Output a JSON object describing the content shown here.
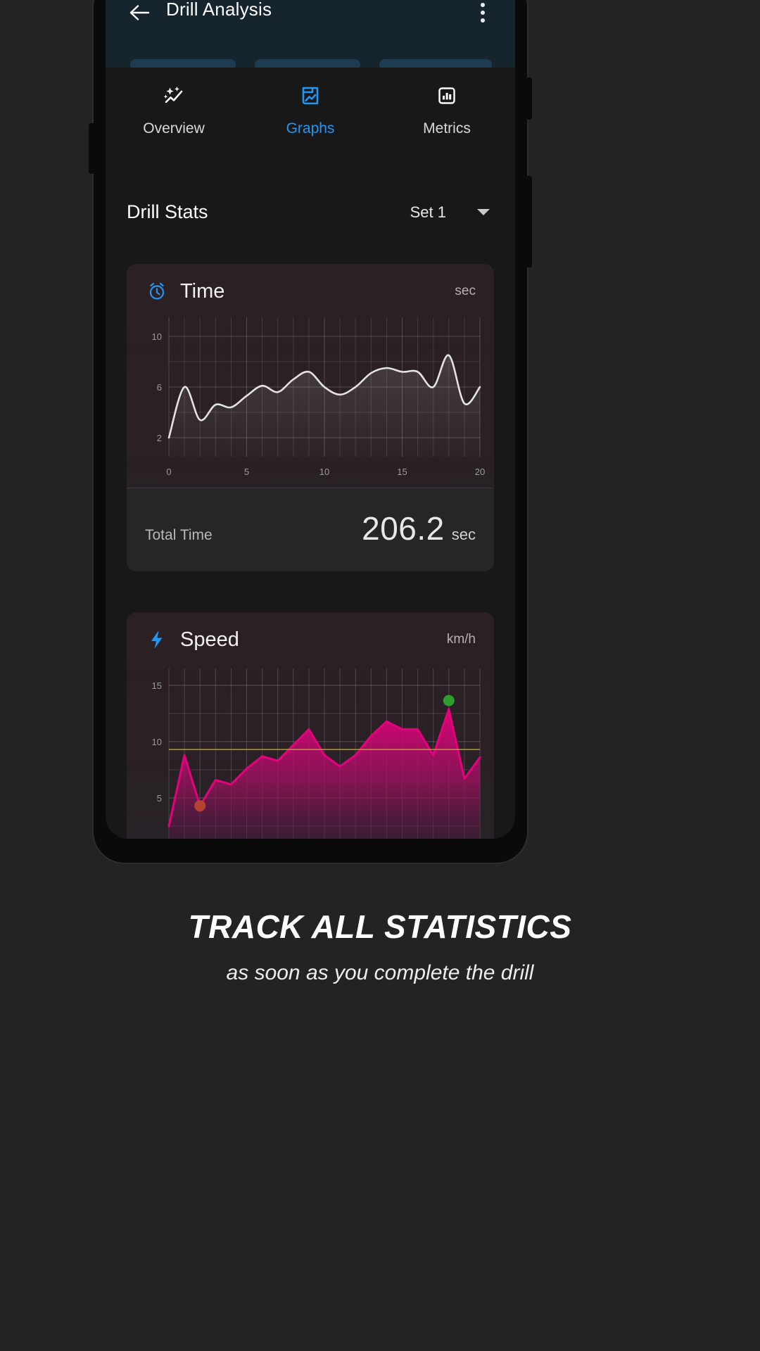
{
  "appbar": {
    "title": "Drill Analysis",
    "back_icon": "arrow-left-icon",
    "overflow_icon": "more-vertical-icon"
  },
  "tabs": [
    {
      "label": "Overview",
      "icon": "sparkle-trend-icon",
      "active": false
    },
    {
      "label": "Graphs",
      "icon": "chart-document-icon",
      "active": true
    },
    {
      "label": "Metrics",
      "icon": "bar-chart-box-icon",
      "active": false
    }
  ],
  "section": {
    "title": "Drill Stats",
    "set_selector": {
      "value": "Set 1",
      "caret_icon": "chevron-down-icon"
    }
  },
  "cards": [
    {
      "title": "Time",
      "unit": "sec",
      "icon": "alarm-clock-icon",
      "footer_label": "Total Time",
      "footer_value": "206.2",
      "footer_unit": "sec"
    },
    {
      "title": "Speed",
      "unit": "km/h",
      "icon": "lightning-bolt-icon"
    }
  ],
  "marketing": {
    "title": "TRACK ALL STATISTICS",
    "subtitle": "as soon as you complete the drill"
  },
  "colors": {
    "accent_blue": "#2196f3",
    "appbar_bg": "#16242e",
    "screen_bg": "#181818",
    "speed_line": "#e5007e",
    "time_line": "#e3e3e3",
    "min_marker": "#b5432f",
    "max_marker": "#2e9e2e",
    "avg_line": "#b89c2a"
  },
  "chart_data": [
    {
      "type": "line",
      "title": "Time",
      "xlabel": "",
      "ylabel": "sec",
      "x": [
        0,
        1,
        2,
        3,
        4,
        5,
        6,
        7,
        8,
        9,
        10,
        11,
        12,
        13,
        14,
        15,
        16,
        17,
        18,
        19,
        20
      ],
      "xticks": [
        0,
        5,
        10,
        15,
        20
      ],
      "yticks": [
        2,
        6,
        10
      ],
      "xlim": [
        0,
        20
      ],
      "ylim": [
        0.5,
        11.5
      ],
      "grid": true,
      "legend": "none",
      "series": [
        {
          "name": "Time",
          "color": "#e3e3e3",
          "values": [
            2.0,
            6.0,
            3.4,
            4.6,
            4.4,
            5.3,
            6.1,
            5.6,
            6.6,
            7.2,
            6.0,
            5.4,
            6.0,
            7.1,
            7.5,
            7.2,
            7.2,
            6.0,
            8.5,
            4.7,
            6.0
          ]
        }
      ]
    },
    {
      "type": "area",
      "title": "Speed",
      "xlabel": "",
      "ylabel": "km/h",
      "x": [
        0,
        1,
        2,
        3,
        4,
        5,
        6,
        7,
        8,
        9,
        10,
        11,
        12,
        13,
        14,
        15,
        16,
        17,
        18,
        19,
        20
      ],
      "yticks": [
        5,
        10,
        15
      ],
      "xlim": [
        0,
        20
      ],
      "ylim": [
        1.0,
        16.5
      ],
      "grid": true,
      "legend": "none",
      "average_line": 9.3,
      "min_marker": {
        "x": 2,
        "y": 4.3
      },
      "max_marker": {
        "x": 18,
        "y": 12.9
      },
      "series": [
        {
          "name": "Speed",
          "color": "#e5007e",
          "values": [
            2.5,
            8.8,
            4.3,
            6.6,
            6.2,
            7.6,
            8.7,
            8.3,
            9.7,
            11.1,
            8.8,
            7.8,
            8.8,
            10.5,
            11.8,
            11.1,
            11.1,
            8.8,
            12.9,
            6.7,
            8.6
          ]
        }
      ]
    }
  ]
}
